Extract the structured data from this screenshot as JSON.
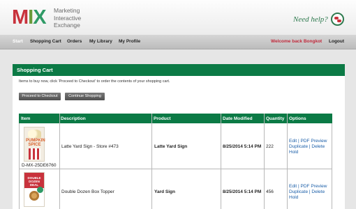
{
  "header": {
    "logo": {
      "m": "M",
      "i": "I",
      "x": "X"
    },
    "tagline": [
      "Marketing",
      "Interactive",
      "Exchange"
    ],
    "need_help": "Need help?"
  },
  "nav": {
    "start": "Start",
    "shopping_cart": "Shopping Cart",
    "orders": "Orders",
    "my_library": "My Library",
    "my_profile": "My Profile",
    "welcome": "Welcome back Bongkot",
    "logout": "Logout"
  },
  "panel": {
    "title": "Shopping Cart",
    "instructions": "Items to buy now, click 'Proceed to Checkout' to order the contents of your shopping cart.",
    "proceed_button": "Proceed to Checkout",
    "continue_button": "Continue Shopping"
  },
  "table": {
    "headers": [
      "Item",
      "Description",
      "Product",
      "Date Modified",
      "Quantity",
      "Options"
    ],
    "rows": [
      {
        "item_id": "D-MX-25DE6760",
        "thumb_text": "PUMPKIN SPICE",
        "description": "Latte Yard Sign - Store #473",
        "product": "Latte Yard Sign",
        "date": "8/25/2014 5:14 PM",
        "quantity": "222",
        "options": {
          "edit": "Edit",
          "pdf": "PDF Preview",
          "duplicate": "Duplicate",
          "delete": "Delete",
          "hold": "Hold"
        }
      },
      {
        "item_id": "",
        "thumb_text": "DOUBLE DOZEN DEAL",
        "description": "Double Dozen Box Topper",
        "product": "Yard Sign",
        "date": "8/25/2014 5:14 PM",
        "quantity": "456",
        "options": {
          "edit": "Edit",
          "pdf": "PDF Preview",
          "duplicate": "Duplicate",
          "delete": "Delete",
          "hold": "Hold"
        }
      }
    ]
  },
  "colors": {
    "brand_green": "#0b7a45",
    "brand_red": "#c8323c",
    "link_blue": "#1a5ea8"
  },
  "icons": {
    "help": "chat-bubble-icon"
  }
}
